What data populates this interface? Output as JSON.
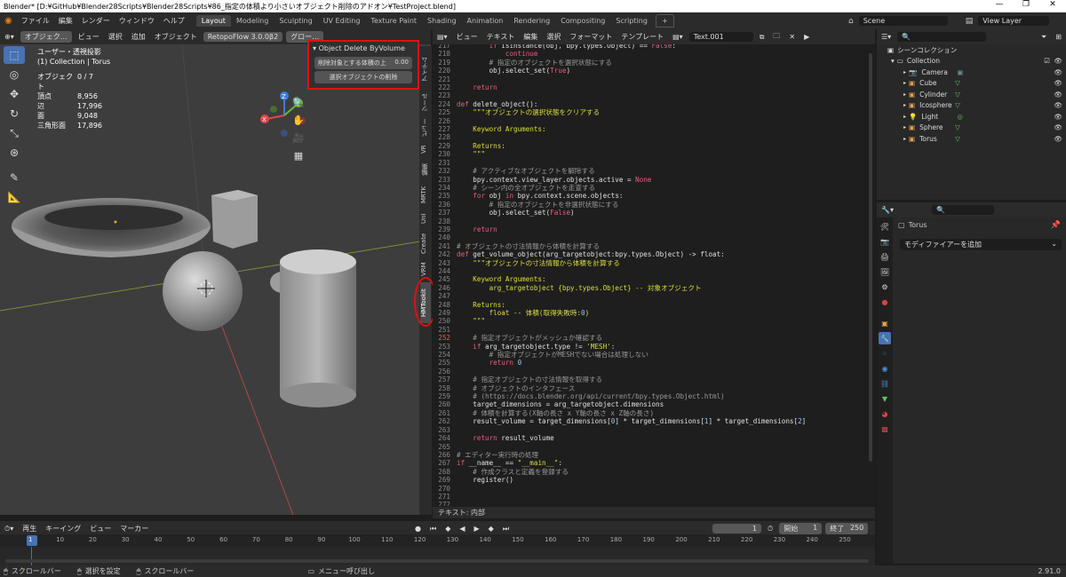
{
  "title": {
    "text": "Blender* [D:¥GitHub¥Blender28Scripts¥Blender28Scripts¥86_指定の体積より小さいオブジェクト削除のアドオン¥TestProject.blend]",
    "min": "—",
    "max": "❐",
    "close": "✕"
  },
  "menu": {
    "items": [
      "ファイル",
      "編集",
      "レンダー",
      "ウィンドウ",
      "ヘルプ"
    ],
    "workspaces": [
      "Layout",
      "Modeling",
      "Sculpting",
      "UV Editing",
      "Texture Paint",
      "Shading",
      "Animation",
      "Rendering",
      "Compositing",
      "Scripting"
    ],
    "add": "+",
    "scene": "Scene",
    "view_layer": "View Layer"
  },
  "viewport": {
    "header": {
      "mode": "オブジェク…",
      "items": [
        "ビュー",
        "選択",
        "追加",
        "オブジェクト"
      ],
      "retopo": "RetopoFlow 3.0.0β2",
      "global": "グロー…"
    },
    "overlay": {
      "view_name": "ユーザー・透視投影",
      "collection": "(1) Collection | Torus",
      "stats_title": "オブジェクト",
      "stats_title_val": "0 / 7",
      "stats": [
        {
          "k": "頂点",
          "v": "8,956"
        },
        {
          "k": "辺",
          "v": "17,996"
        },
        {
          "k": "面",
          "v": "9,048"
        },
        {
          "k": "三角形面",
          "v": "17,896"
        }
      ]
    },
    "npanel": {
      "title": "Object Delete ByVolume",
      "field_label": "削除対象とする体積の上",
      "field_value": "0.00",
      "button": "選択オブジェクトの削除"
    },
    "sidetabs": [
      "アイテム",
      "ツール",
      "ビュー",
      "VR",
      "編集",
      "MRTK",
      "UnI",
      "Create",
      "VRM",
      "HMTookit"
    ],
    "gizmo": {
      "x": "X",
      "y": "Y",
      "z": "Z"
    }
  },
  "text_editor": {
    "header": {
      "items": [
        "ビュー",
        "テキスト",
        "編集",
        "選択",
        "フォーマット",
        "テンプレート"
      ],
      "file": "Text.001"
    },
    "status": "テキスト: 内部",
    "lines": [
      {
        "n": "217",
        "c": "        if isinstance(obj, bpy.types.Object) == False:"
      },
      {
        "n": "218",
        "c": "            continue"
      },
      {
        "n": "219",
        "c": "        # 指定のオブジェクトを選択状態にする"
      },
      {
        "n": "220",
        "c": "        obj.select_set(True)"
      },
      {
        "n": "221",
        "c": ""
      },
      {
        "n": "222",
        "c": "    return"
      },
      {
        "n": "223",
        "c": ""
      },
      {
        "n": "224",
        "c": "def delete_object():"
      },
      {
        "n": "225",
        "c": "    \"\"\"オブジェクトの選択状態をクリアする"
      },
      {
        "n": "226",
        "c": ""
      },
      {
        "n": "227",
        "c": "    Keyword Arguments:"
      },
      {
        "n": "228",
        "c": ""
      },
      {
        "n": "229",
        "c": "    Returns:"
      },
      {
        "n": "230",
        "c": "    \"\"\""
      },
      {
        "n": "231",
        "c": ""
      },
      {
        "n": "232",
        "c": "    # アクティブなオブジェクトを解除する"
      },
      {
        "n": "233",
        "c": "    bpy.context.view_layer.objects.active = None"
      },
      {
        "n": "234",
        "c": "    # シーン内の全オブジェクトを走査する"
      },
      {
        "n": "235",
        "c": "    for obj in bpy.context.scene.objects:"
      },
      {
        "n": "236",
        "c": "        # 指定のオブジェクトを非選択状態にする"
      },
      {
        "n": "237",
        "c": "        obj.select_set(False)"
      },
      {
        "n": "238",
        "c": ""
      },
      {
        "n": "239",
        "c": "    return"
      },
      {
        "n": "240",
        "c": ""
      },
      {
        "n": "241",
        "c": "# オブジェクトの寸法情報から体積を計算する"
      },
      {
        "n": "242",
        "c": "def get_volume_object(arg_targetobject:bpy.types.Object) -> float:"
      },
      {
        "n": "243",
        "c": "    \"\"\"オブジェクトの寸法情報から体積を計算する"
      },
      {
        "n": "244",
        "c": ""
      },
      {
        "n": "245",
        "c": "    Keyword Arguments:"
      },
      {
        "n": "246",
        "c": "        arg_targetobject {bpy.types.Object} -- 対象オブジェクト"
      },
      {
        "n": "247",
        "c": ""
      },
      {
        "n": "248",
        "c": "    Returns:"
      },
      {
        "n": "249",
        "c": "        float -- 体積(取得失敗時:0)"
      },
      {
        "n": "250",
        "c": "    \"\"\""
      },
      {
        "n": "251",
        "c": ""
      },
      {
        "n": "252",
        "c": "    # 指定オブジェクトがメッシュか確認する"
      },
      {
        "n": "253",
        "c": "    if arg_targetobject.type != 'MESH':"
      },
      {
        "n": "254",
        "c": "        # 指定オブジェクトがMESHでない場合は処理しない"
      },
      {
        "n": "255",
        "c": "        return 0"
      },
      {
        "n": "256",
        "c": ""
      },
      {
        "n": "257",
        "c": "    # 指定オブジェクトの寸法情報を取得する"
      },
      {
        "n": "258",
        "c": "    # オブジェクトのインタフェース"
      },
      {
        "n": "259",
        "c": "    # (https://docs.blender.org/api/current/bpy.types.Object.html)"
      },
      {
        "n": "260",
        "c": "    target_dimensions = arg_targetobject.dimensions"
      },
      {
        "n": "261",
        "c": "    # 体積を計算する(X軸の長さ x Y軸の長さ x Z軸の長さ)"
      },
      {
        "n": "262",
        "c": "    result_volume = target_dimensions[0] * target_dimensions[1] * target_dimensions[2]"
      },
      {
        "n": "263",
        "c": ""
      },
      {
        "n": "264",
        "c": "    return result_volume"
      },
      {
        "n": "265",
        "c": ""
      },
      {
        "n": "266",
        "c": "# エディター実行時の処理"
      },
      {
        "n": "267",
        "c": "if __name__ == \"__main__\":"
      },
      {
        "n": "268",
        "c": "    # 作成クラスと定義を登録する"
      },
      {
        "n": "269",
        "c": "    register()"
      },
      {
        "n": "270",
        "c": ""
      },
      {
        "n": "271",
        "c": ""
      },
      {
        "n": "272",
        "c": ""
      }
    ]
  },
  "outliner": {
    "title": "シーンコレクション",
    "collection": "Collection",
    "items": [
      {
        "name": "Camera",
        "color": "#a0a0a0"
      },
      {
        "name": "Cube",
        "color": "#e8a24a"
      },
      {
        "name": "Cylinder",
        "color": "#e8a24a"
      },
      {
        "name": "Icosphere",
        "color": "#e8a24a"
      },
      {
        "name": "Light",
        "color": "#e8a24a"
      },
      {
        "name": "Sphere",
        "color": "#e8a24a"
      },
      {
        "name": "Torus",
        "color": "#e8a24a"
      }
    ]
  },
  "properties": {
    "object": "Torus",
    "add_modifier": "モディファイアーを追加"
  },
  "timeline": {
    "items": [
      "再生",
      "キーイング",
      "ビュー",
      "マーカー"
    ],
    "current": "1",
    "start_label": "開始",
    "start": "1",
    "end_label": "終了",
    "end": "250",
    "ticks": [
      "1",
      "10",
      "20",
      "30",
      "40",
      "50",
      "60",
      "70",
      "80",
      "90",
      "100",
      "110",
      "120",
      "130",
      "140",
      "150",
      "160",
      "170",
      "180",
      "190",
      "200",
      "210",
      "220",
      "230",
      "240",
      "250"
    ]
  },
  "statusbar": {
    "items": [
      "スクロールバー",
      "選択を設定",
      "スクロールバー",
      "メニュー呼び出し"
    ],
    "version": "2.91.0"
  }
}
